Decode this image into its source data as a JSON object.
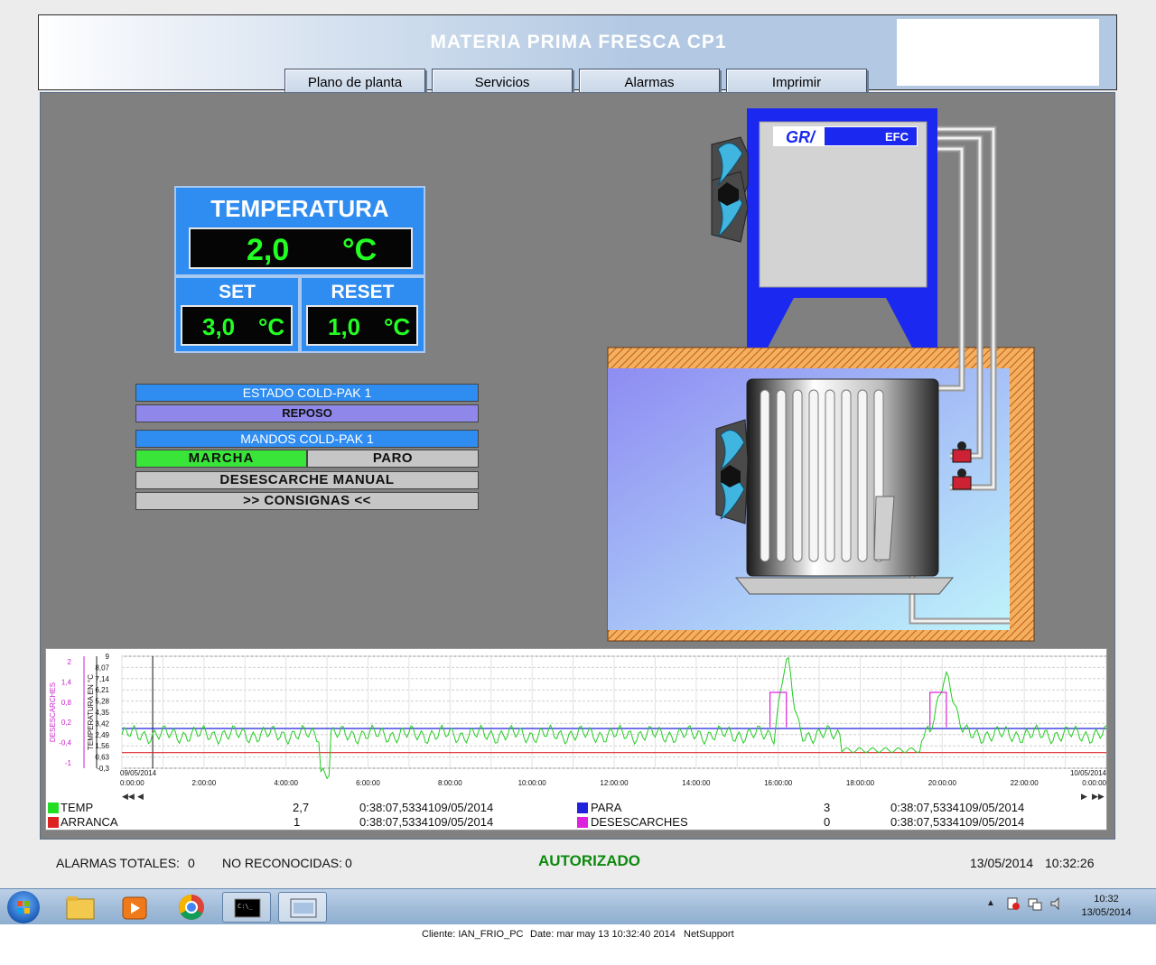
{
  "header": {
    "title": "MATERIA PRIMA FRESCA CP1"
  },
  "nav": [
    {
      "label": "Plano de planta"
    },
    {
      "label": "Servicios"
    },
    {
      "label": "Alarmas"
    },
    {
      "label": "Imprimir"
    }
  ],
  "temperature": {
    "title": "TEMPERATURA",
    "value": "2,0",
    "unit": "°C",
    "set_label": "SET",
    "set_value": "3,0",
    "reset_label": "RESET",
    "reset_value": "1,0"
  },
  "estado": {
    "title": "ESTADO COLD-PAK 1",
    "value": "REPOSO"
  },
  "mandos": {
    "title": "MANDOS COLD-PAK 1",
    "marcha": "MARCHA",
    "paro": "PARO",
    "desescarche": "DESESCARCHE MANUAL",
    "consignas": ">>  CONSIGNAS  <<"
  },
  "equipment": {
    "brand": "EFC"
  },
  "trend": {
    "y_label": "TEMPERATURA EN °C",
    "y2_label": "DESESCARCHES",
    "y_ticks": [
      "9",
      "8,07",
      "7,14",
      "6,21",
      "5,28",
      "4,35",
      "3,42",
      "2,49",
      "1,56",
      "0,63",
      "-0,3"
    ],
    "y2_ticks": [
      "2",
      "1,4",
      "0,8",
      "0,2",
      "-0,4",
      "-1"
    ],
    "x_ticks": [
      "2:00:00",
      "4:00:00",
      "6:00:00",
      "8:00:00",
      "10:00:00",
      "12:00:00",
      "14:00:00",
      "16:00:00",
      "18:00:00",
      "20:00:00",
      "22:00:00"
    ],
    "x_start_date": "09/05/2014",
    "x_start_time": "0:00:00",
    "x_end_date": "10/05/2014",
    "x_end_time": "0:00:00",
    "legend": [
      {
        "name": "TEMP",
        "value": "2,7",
        "time": "0:38:07,5334109/05/2014",
        "color": "#22dd22"
      },
      {
        "name": "ARRANCA",
        "value": "1",
        "time": "0:38:07,5334109/05/2014",
        "color": "#dd2222"
      },
      {
        "name": "PARA",
        "value": "3",
        "time": "0:38:07,5334109/05/2014",
        "color": "#2222dd"
      },
      {
        "name": "DESESCARCHES",
        "value": "0",
        "time": "0:38:07,5334109/05/2014",
        "color": "#dd22dd"
      }
    ]
  },
  "status_bar": {
    "alarmas_label": "ALARMAS TOTALES:",
    "alarmas_value": "0",
    "noreconocidas_label": "NO RECONOCIDAS:",
    "noreconocidas_value": "0",
    "autorizado": "AUTORIZADO",
    "date": "13/05/2014",
    "time": "10:32:26"
  },
  "taskbar": {
    "clock_time": "10:32",
    "clock_date": "13/05/2014"
  },
  "footer": {
    "cliente": "Cliente: IAN_FRIO_PC",
    "date": "Date: mar may 13 10:32:40 2014",
    "product": "NetSupport"
  }
}
